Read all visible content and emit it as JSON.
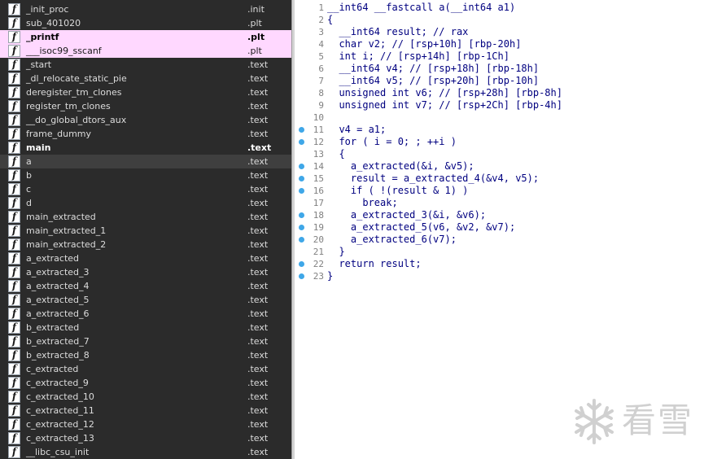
{
  "functions": [
    {
      "name": "_init_proc",
      "segment": ".init",
      "style": ""
    },
    {
      "name": "sub_401020",
      "segment": ".plt",
      "style": ""
    },
    {
      "name": "_printf",
      "segment": ".plt",
      "style": "hl bold"
    },
    {
      "name": "___isoc99_sscanf",
      "segment": ".plt",
      "style": "hl"
    },
    {
      "name": "_start",
      "segment": ".text",
      "style": ""
    },
    {
      "name": "_dl_relocate_static_pie",
      "segment": ".text",
      "style": ""
    },
    {
      "name": "deregister_tm_clones",
      "segment": ".text",
      "style": ""
    },
    {
      "name": "register_tm_clones",
      "segment": ".text",
      "style": ""
    },
    {
      "name": "__do_global_dtors_aux",
      "segment": ".text",
      "style": ""
    },
    {
      "name": "frame_dummy",
      "segment": ".text",
      "style": ""
    },
    {
      "name": "main",
      "segment": ".text",
      "style": "bold"
    },
    {
      "name": "a",
      "segment": ".text",
      "style": "sel"
    },
    {
      "name": "b",
      "segment": ".text",
      "style": ""
    },
    {
      "name": "c",
      "segment": ".text",
      "style": ""
    },
    {
      "name": "d",
      "segment": ".text",
      "style": ""
    },
    {
      "name": "main_extracted",
      "segment": ".text",
      "style": ""
    },
    {
      "name": "main_extracted_1",
      "segment": ".text",
      "style": ""
    },
    {
      "name": "main_extracted_2",
      "segment": ".text",
      "style": ""
    },
    {
      "name": "a_extracted",
      "segment": ".text",
      "style": ""
    },
    {
      "name": "a_extracted_3",
      "segment": ".text",
      "style": ""
    },
    {
      "name": "a_extracted_4",
      "segment": ".text",
      "style": ""
    },
    {
      "name": "a_extracted_5",
      "segment": ".text",
      "style": ""
    },
    {
      "name": "a_extracted_6",
      "segment": ".text",
      "style": ""
    },
    {
      "name": "b_extracted",
      "segment": ".text",
      "style": ""
    },
    {
      "name": "b_extracted_7",
      "segment": ".text",
      "style": ""
    },
    {
      "name": "b_extracted_8",
      "segment": ".text",
      "style": ""
    },
    {
      "name": "c_extracted",
      "segment": ".text",
      "style": ""
    },
    {
      "name": "c_extracted_9",
      "segment": ".text",
      "style": ""
    },
    {
      "name": "c_extracted_10",
      "segment": ".text",
      "style": ""
    },
    {
      "name": "c_extracted_11",
      "segment": ".text",
      "style": ""
    },
    {
      "name": "c_extracted_12",
      "segment": ".text",
      "style": ""
    },
    {
      "name": "c_extracted_13",
      "segment": ".text",
      "style": ""
    },
    {
      "name": "__libc_csu_init",
      "segment": ".text",
      "style": ""
    }
  ],
  "function_icon": "function-icon",
  "code_lines": [
    {
      "num": "1",
      "bp": false,
      "text": "__int64 __fastcall a(__int64 a1)"
    },
    {
      "num": "2",
      "bp": false,
      "text": "{"
    },
    {
      "num": "3",
      "bp": false,
      "text": "  __int64 result; // rax"
    },
    {
      "num": "4",
      "bp": false,
      "text": "  char v2; // [rsp+10h] [rbp-20h]"
    },
    {
      "num": "5",
      "bp": false,
      "text": "  int i; // [rsp+14h] [rbp-1Ch]"
    },
    {
      "num": "6",
      "bp": false,
      "text": "  __int64 v4; // [rsp+18h] [rbp-18h]"
    },
    {
      "num": "7",
      "bp": false,
      "text": "  __int64 v5; // [rsp+20h] [rbp-10h]"
    },
    {
      "num": "8",
      "bp": false,
      "text": "  unsigned int v6; // [rsp+28h] [rbp-8h]"
    },
    {
      "num": "9",
      "bp": false,
      "text": "  unsigned int v7; // [rsp+2Ch] [rbp-4h]"
    },
    {
      "num": "10",
      "bp": false,
      "text": ""
    },
    {
      "num": "11",
      "bp": true,
      "text": "  v4 = a1;"
    },
    {
      "num": "12",
      "bp": true,
      "text": "  for ( i = 0; ; ++i )"
    },
    {
      "num": "13",
      "bp": false,
      "text": "  {"
    },
    {
      "num": "14",
      "bp": true,
      "text": "    a_extracted(&i, &v5);"
    },
    {
      "num": "15",
      "bp": true,
      "text": "    result = a_extracted_4(&v4, v5);"
    },
    {
      "num": "16",
      "bp": true,
      "text": "    if ( !(result & 1) )"
    },
    {
      "num": "17",
      "bp": false,
      "text": "      break;"
    },
    {
      "num": "18",
      "bp": true,
      "text": "    a_extracted_3(&i, &v6);"
    },
    {
      "num": "19",
      "bp": true,
      "text": "    a_extracted_5(v6, &v2, &v7);"
    },
    {
      "num": "20",
      "bp": true,
      "text": "    a_extracted_6(v7);"
    },
    {
      "num": "21",
      "bp": false,
      "text": "  }"
    },
    {
      "num": "22",
      "bp": true,
      "text": "  return result;"
    },
    {
      "num": "23",
      "bp": true,
      "text": "}"
    }
  ],
  "watermark": {
    "text": "看雪",
    "icon": "snowflake-icon"
  },
  "colors": {
    "list_bg": "#2b2b2b",
    "import_highlight": "#ffd8ff",
    "breakpoint": "#3fa7e8",
    "code_text": "#000080",
    "code_var": "#3030ff",
    "code_comment": "#4080ff"
  }
}
